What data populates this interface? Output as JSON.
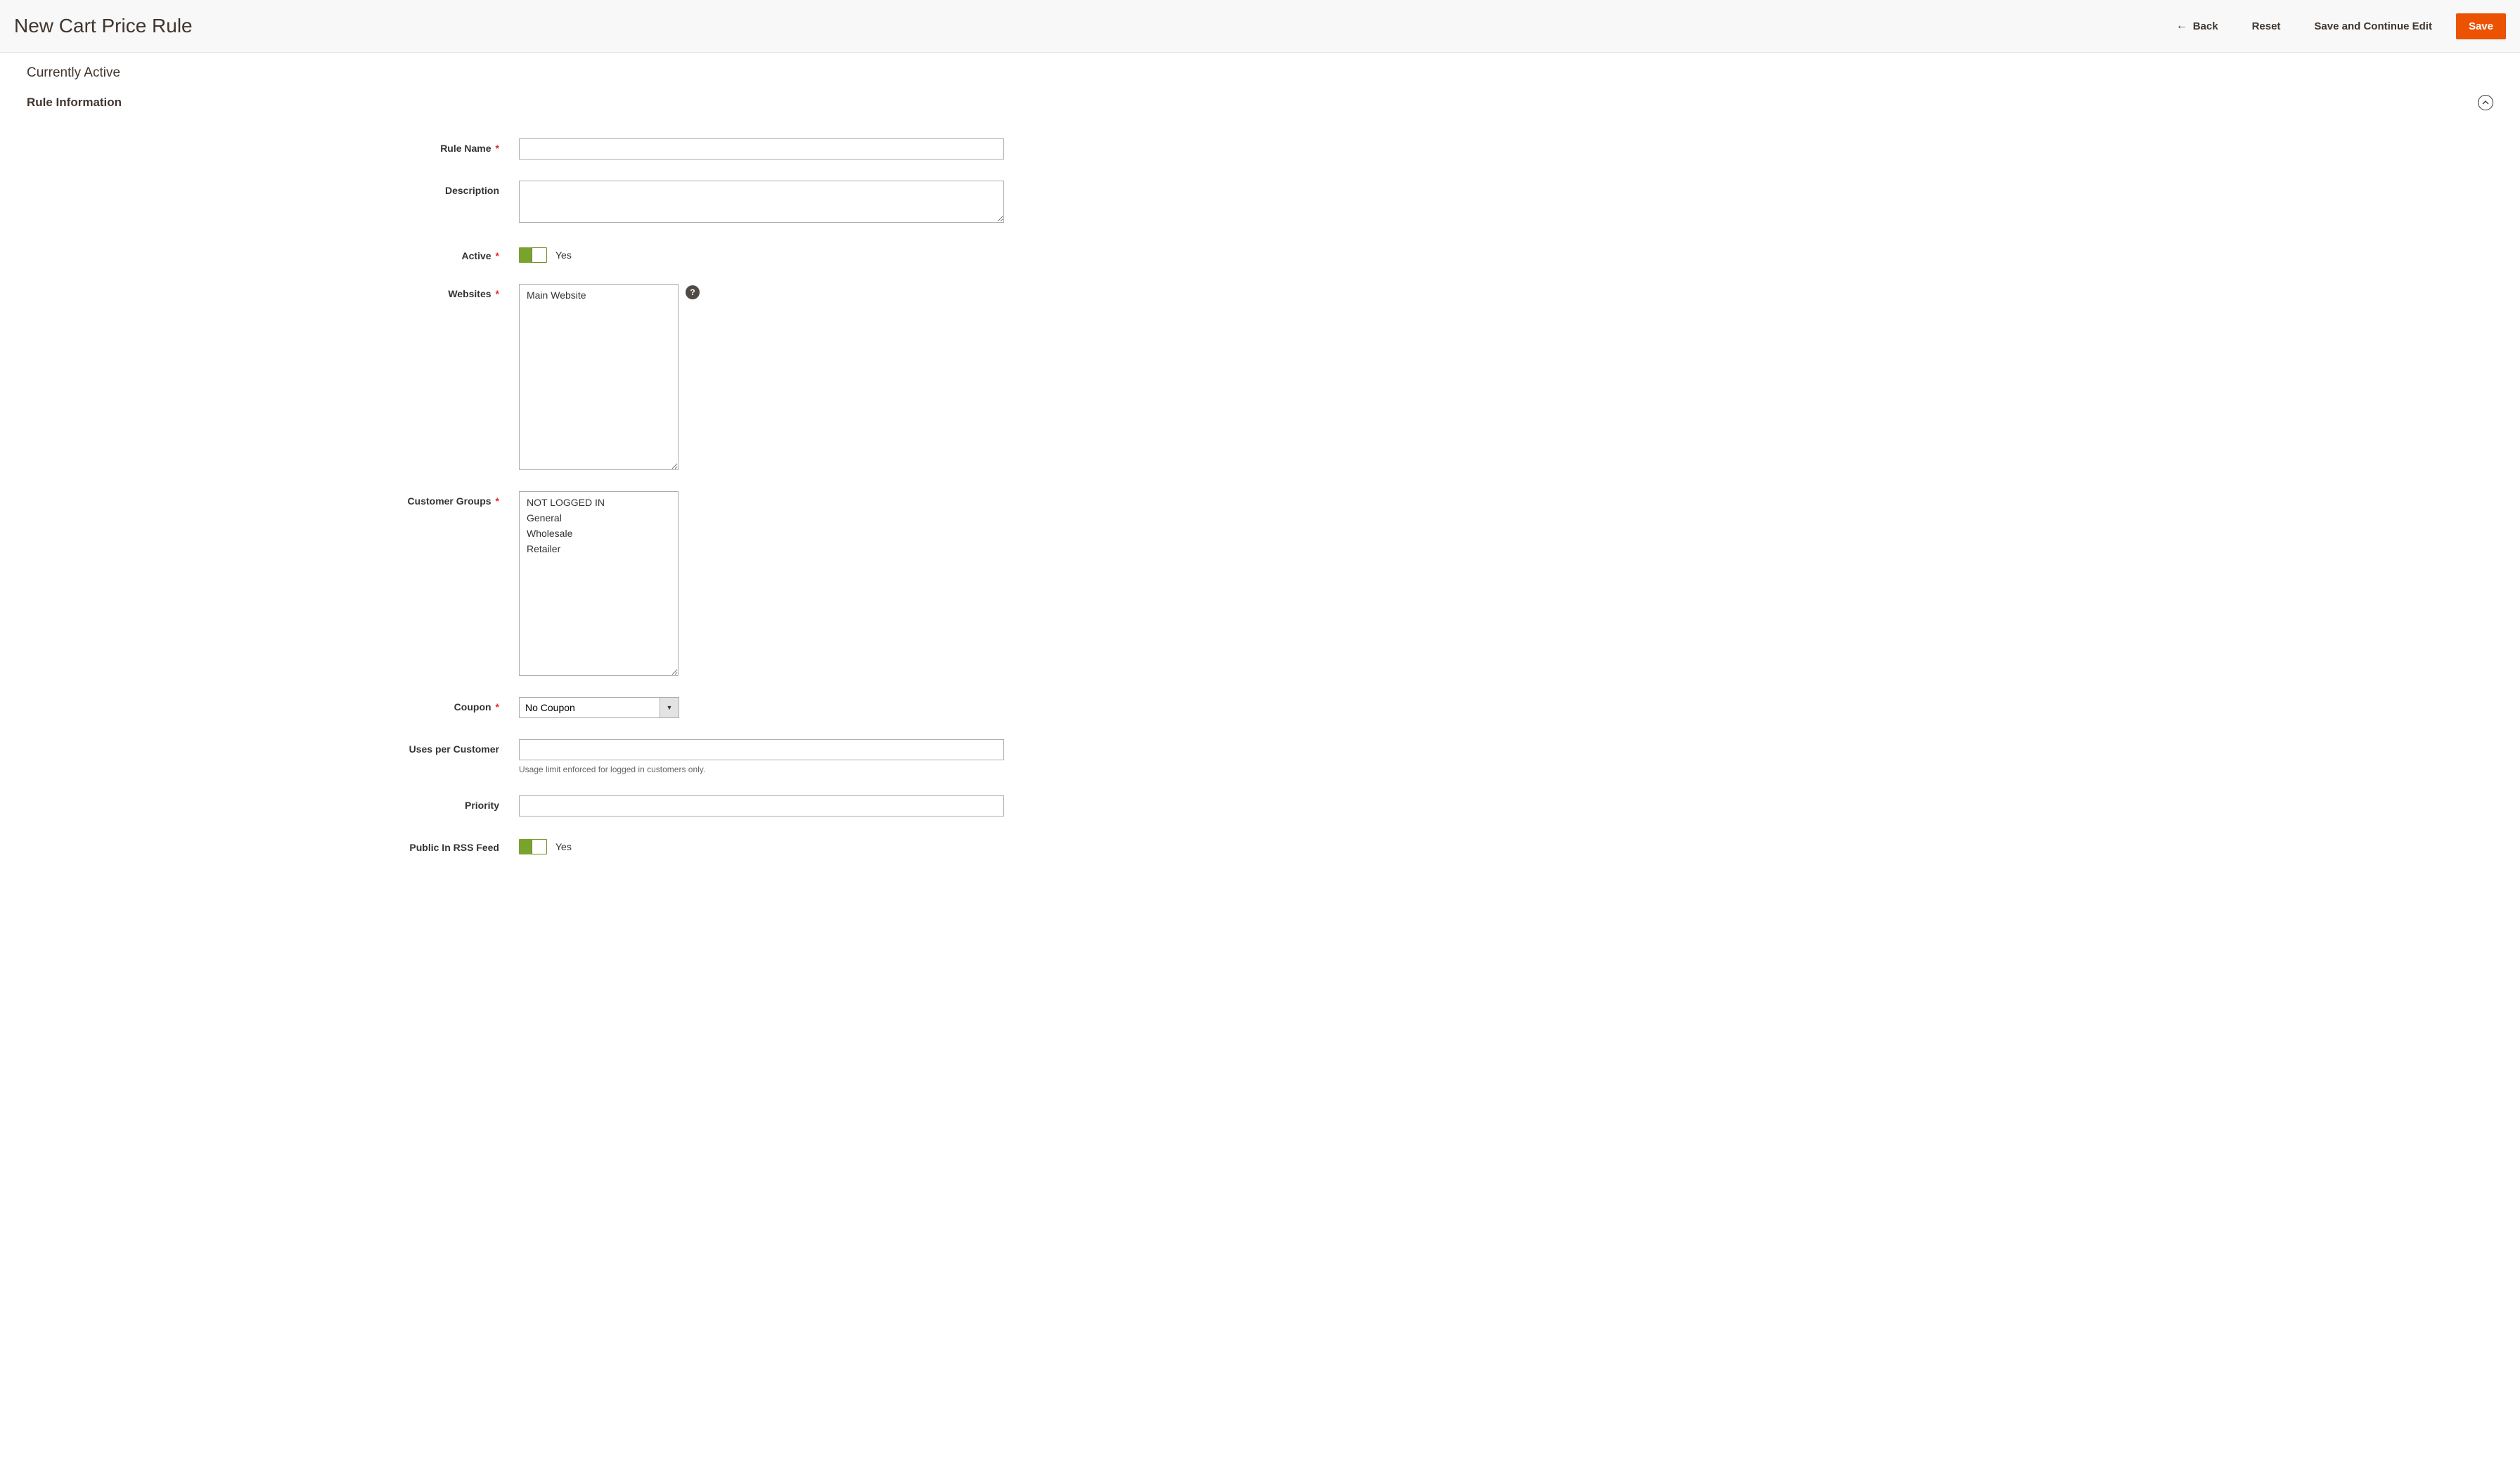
{
  "header": {
    "title": "New Cart Price Rule",
    "back": "Back",
    "reset": "Reset",
    "save_continue": "Save and Continue Edit",
    "save": "Save"
  },
  "subtitle": "Currently Active",
  "section_title": "Rule Information",
  "form": {
    "rule_name_label": "Rule Name",
    "rule_name_value": "",
    "description_label": "Description",
    "description_value": "",
    "active_label": "Active",
    "active_text": "Yes",
    "websites_label": "Websites",
    "websites_options": [
      "Main Website"
    ],
    "customer_groups_label": "Customer Groups",
    "customer_groups_options": [
      "NOT LOGGED IN",
      "General",
      "Wholesale",
      "Retailer"
    ],
    "coupon_label": "Coupon",
    "coupon_value": "No Coupon",
    "uses_per_customer_label": "Uses per Customer",
    "uses_per_customer_value": "",
    "uses_note": "Usage limit enforced for logged in customers only.",
    "priority_label": "Priority",
    "priority_value": "",
    "rss_label": "Public In RSS Feed",
    "rss_text": "Yes"
  }
}
